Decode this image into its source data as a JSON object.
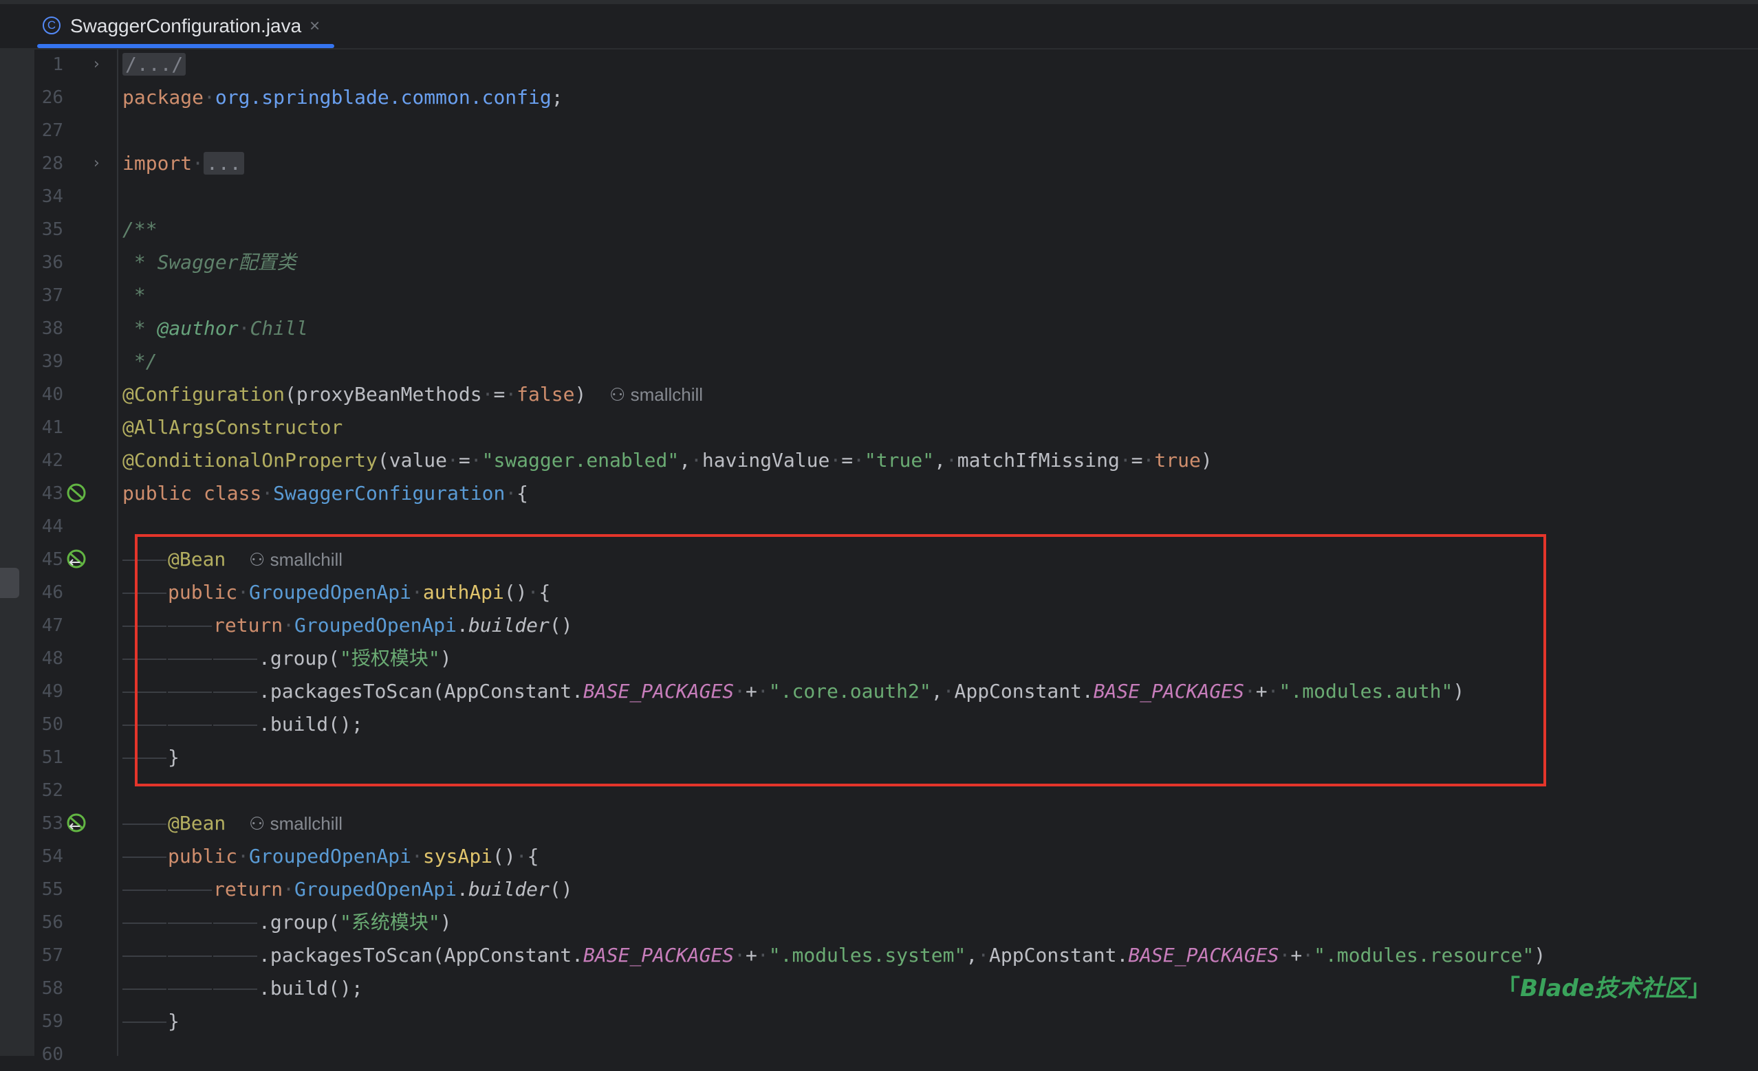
{
  "tab": {
    "title": "SwaggerConfiguration.java",
    "close": "×",
    "icon": "class-c-icon"
  },
  "gutter": {
    "line_numbers": [
      "1",
      "26",
      "27",
      "28",
      "34",
      "35",
      "36",
      "37",
      "38",
      "39",
      "40",
      "41",
      "42",
      "43",
      "44",
      "45",
      "46",
      "47",
      "48",
      "49",
      "50",
      "51",
      "52",
      "53",
      "54",
      "55",
      "56",
      "57",
      "58",
      "59",
      "60"
    ]
  },
  "code": {
    "l1": "/.../",
    "l26_kw": "package",
    "l26_pkg": "org.springblade.common.config",
    "l28_kw": "import",
    "l28_fold": "...",
    "l35": "/**",
    "l36_star": " * ",
    "l36_text": "Swagger配置类",
    "l37": " *",
    "l38_star": " * ",
    "l38_tag": "@author",
    "l38_name": "Chill",
    "l39": " */",
    "l40_ann": "@Configuration",
    "l40_param": "proxyBeanMethods",
    "l40_val": "false",
    "author_hint": "smallchill",
    "l41_ann": "@AllArgsConstructor",
    "l42_ann": "@ConditionalOnProperty",
    "l42_p1": "value",
    "l42_v1": "\"swagger.enabled\"",
    "l42_p2": "havingValue",
    "l42_v2": "\"true\"",
    "l42_p3": "matchIfMissing",
    "l42_v3": "true",
    "l43_mods": "public class",
    "l43_name": "SwaggerConfiguration",
    "bean": "@Bean",
    "public": "public",
    "ret_type": "GroupedOpenApi",
    "auth_method": "authApi",
    "sys_method": "sysApi",
    "return": "return",
    "builder_cls": "GroupedOpenApi",
    "builder_fn": "builder",
    "group_fn": ".group(",
    "auth_group": "\"授权模块\"",
    "sys_group": "\"系统模块\"",
    "scan_fn": ".packagesToScan(AppConstant.",
    "appconst": "AppConstant.",
    "base_pkgs": "BASE_PACKAGES",
    "auth_pkg1": "\".core.oauth2\"",
    "auth_pkg2": "\".modules.auth\"",
    "sys_pkg1": "\".modules.system\"",
    "sys_pkg2": "\".modules.resource\"",
    "build_fn": ".build();"
  },
  "watermark": {
    "open": "「",
    "text": "Blade技术社区",
    "close": "」"
  },
  "colors": {
    "highlight_box": "#e4352b",
    "watermark": "#3aa35b",
    "tab_underline": "#3574f0"
  }
}
